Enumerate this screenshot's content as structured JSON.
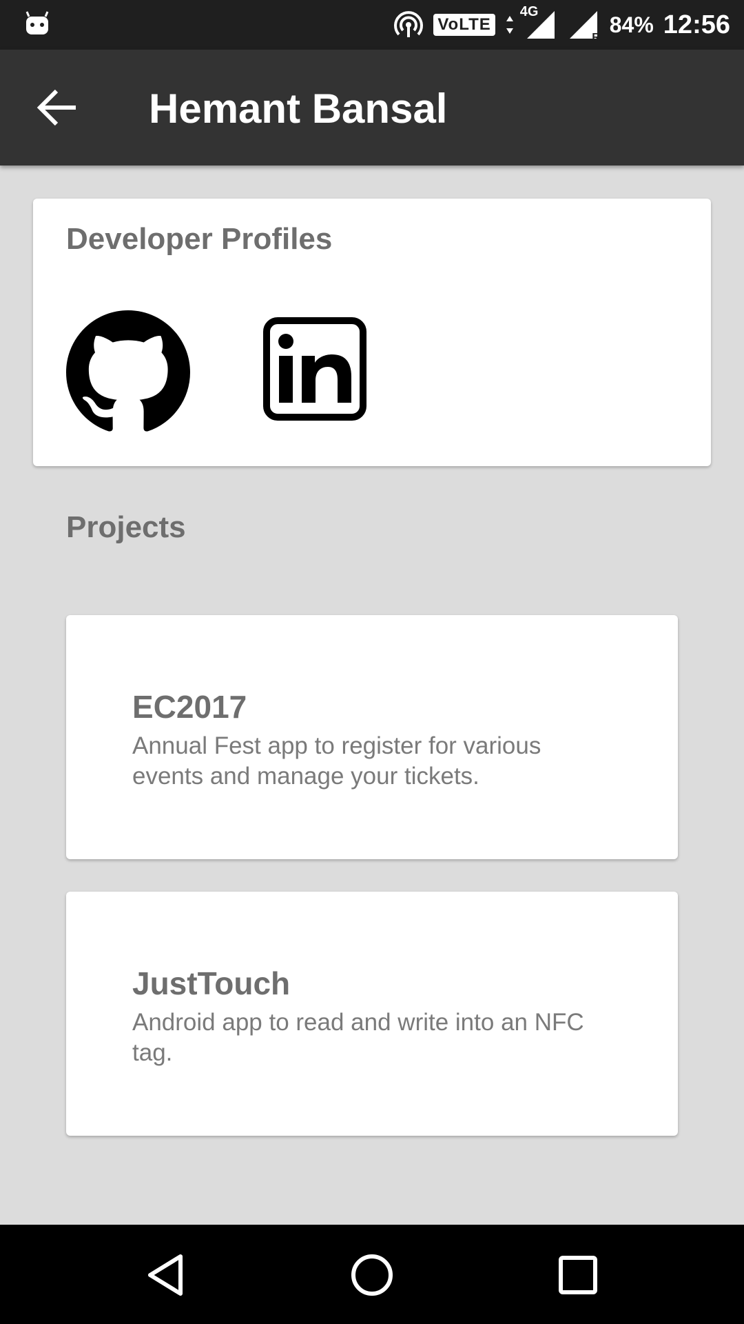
{
  "status_bar": {
    "battery": "84%",
    "time": "12:56",
    "volte": "VoLTE",
    "network": "4G",
    "roaming": "R",
    "icons": [
      "android-notification-icon",
      "hotspot-icon",
      "volte-icon",
      "data-arrows-icon",
      "signal-icon",
      "signal-roaming-icon"
    ]
  },
  "app_bar": {
    "title": "Hemant Bansal",
    "back_icon": "arrow-back-icon"
  },
  "profiles": {
    "title": "Developer Profiles",
    "links": [
      {
        "icon": "github-icon"
      },
      {
        "icon": "linkedin-icon"
      }
    ]
  },
  "projects": {
    "title": "Projects",
    "items": [
      {
        "name": "EC2017",
        "description": "Annual Fest app to register for various events and manage your tickets."
      },
      {
        "name": "JustTouch",
        "description": "Android app to read and write into an NFC tag."
      }
    ]
  },
  "nav_bar": {
    "icons": [
      "nav-back-icon",
      "nav-home-icon",
      "nav-recents-icon"
    ]
  },
  "colors": {
    "status_bar": "#1f1f1f",
    "app_bar": "#333333",
    "background": "#dcdcdc",
    "card": "#ffffff",
    "heading_text": "#6e6e6e"
  }
}
